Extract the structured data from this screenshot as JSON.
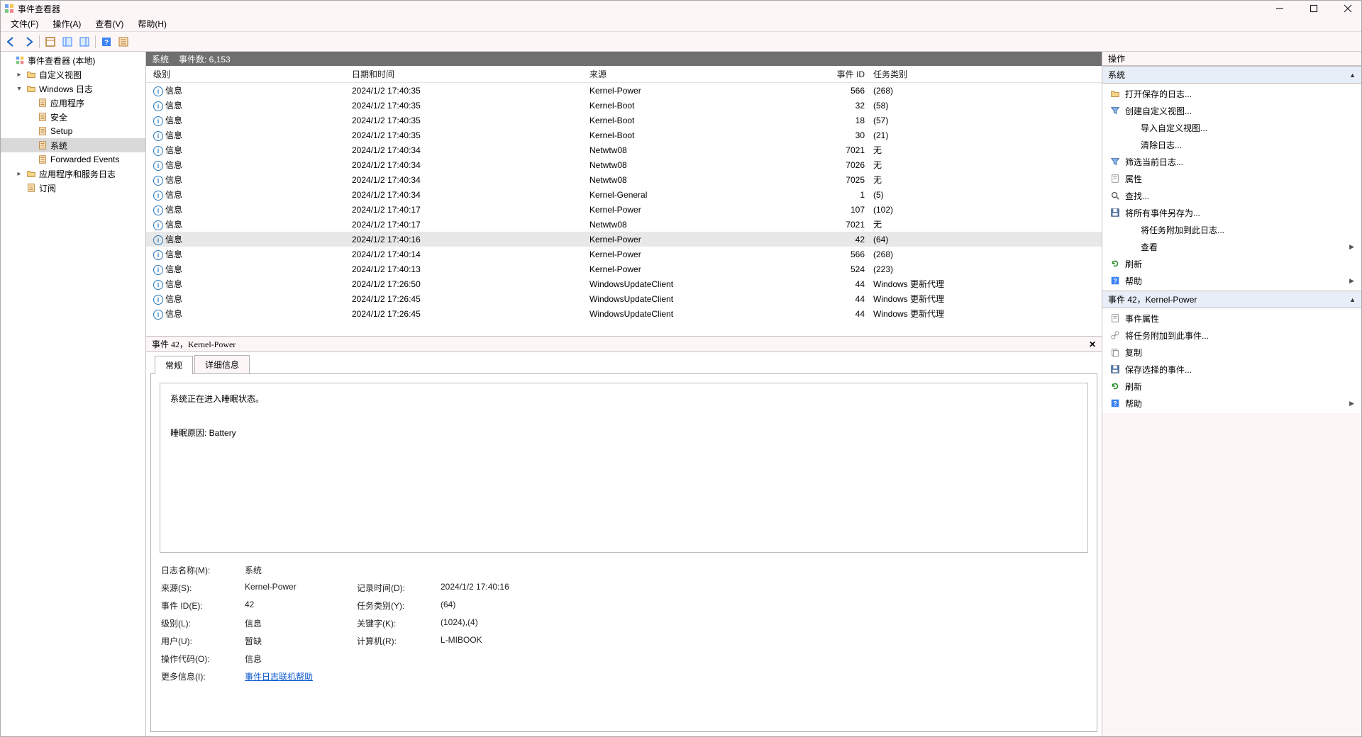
{
  "window": {
    "title": "事件查看器"
  },
  "menubar": [
    "文件(F)",
    "操作(A)",
    "查看(V)",
    "帮助(H)"
  ],
  "tree": {
    "root": "事件查看器 (本地)",
    "items": [
      {
        "label": "自定义视图",
        "indent": 1,
        "exp": "▶"
      },
      {
        "label": "Windows 日志",
        "indent": 1,
        "exp": "▼"
      },
      {
        "label": "应用程序",
        "indent": 2
      },
      {
        "label": "安全",
        "indent": 2
      },
      {
        "label": "Setup",
        "indent": 2
      },
      {
        "label": "系统",
        "indent": 2,
        "selected": true
      },
      {
        "label": "Forwarded Events",
        "indent": 2
      },
      {
        "label": "应用程序和服务日志",
        "indent": 1,
        "exp": "▶"
      },
      {
        "label": "订阅",
        "indent": 1
      }
    ]
  },
  "center_header": {
    "log_name": "系统",
    "count_label": "事件数: 6,153"
  },
  "columns": {
    "level": "级别",
    "datetime": "日期和时间",
    "source": "来源",
    "eventid": "事件 ID",
    "category": "任务类别"
  },
  "events": [
    {
      "level": "信息",
      "dt": "2024/1/2 17:40:35",
      "src": "Kernel-Power",
      "id": "566",
      "cat": "(268)"
    },
    {
      "level": "信息",
      "dt": "2024/1/2 17:40:35",
      "src": "Kernel-Boot",
      "id": "32",
      "cat": "(58)"
    },
    {
      "level": "信息",
      "dt": "2024/1/2 17:40:35",
      "src": "Kernel-Boot",
      "id": "18",
      "cat": "(57)"
    },
    {
      "level": "信息",
      "dt": "2024/1/2 17:40:35",
      "src": "Kernel-Boot",
      "id": "30",
      "cat": "(21)"
    },
    {
      "level": "信息",
      "dt": "2024/1/2 17:40:34",
      "src": "Netwtw08",
      "id": "7021",
      "cat": "无"
    },
    {
      "level": "信息",
      "dt": "2024/1/2 17:40:34",
      "src": "Netwtw08",
      "id": "7026",
      "cat": "无"
    },
    {
      "level": "信息",
      "dt": "2024/1/2 17:40:34",
      "src": "Netwtw08",
      "id": "7025",
      "cat": "无"
    },
    {
      "level": "信息",
      "dt": "2024/1/2 17:40:34",
      "src": "Kernel-General",
      "id": "1",
      "cat": "(5)"
    },
    {
      "level": "信息",
      "dt": "2024/1/2 17:40:17",
      "src": "Kernel-Power",
      "id": "107",
      "cat": "(102)"
    },
    {
      "level": "信息",
      "dt": "2024/1/2 17:40:17",
      "src": "Netwtw08",
      "id": "7021",
      "cat": "无"
    },
    {
      "level": "信息",
      "dt": "2024/1/2 17:40:16",
      "src": "Kernel-Power",
      "id": "42",
      "cat": "(64)",
      "selected": true
    },
    {
      "level": "信息",
      "dt": "2024/1/2 17:40:14",
      "src": "Kernel-Power",
      "id": "566",
      "cat": "(268)"
    },
    {
      "level": "信息",
      "dt": "2024/1/2 17:40:13",
      "src": "Kernel-Power",
      "id": "524",
      "cat": "(223)"
    },
    {
      "level": "信息",
      "dt": "2024/1/2 17:26:50",
      "src": "WindowsUpdateClient",
      "id": "44",
      "cat": "Windows 更新代理"
    },
    {
      "level": "信息",
      "dt": "2024/1/2 17:26:45",
      "src": "WindowsUpdateClient",
      "id": "44",
      "cat": "Windows 更新代理"
    },
    {
      "level": "信息",
      "dt": "2024/1/2 17:26:45",
      "src": "WindowsUpdateClient",
      "id": "44",
      "cat": "Windows 更新代理"
    }
  ],
  "detail": {
    "header": "事件 42，Kernel-Power",
    "tabs": {
      "general": "常规",
      "details": "详细信息"
    },
    "message": "系统正在进入睡眠状态。\n\n睡眠原因: Battery",
    "props": {
      "log_name_lbl": "日志名称(M):",
      "log_name": "系统",
      "source_lbl": "来源(S):",
      "source": "Kernel-Power",
      "logged_lbl": "记录时间(D):",
      "logged": "2024/1/2 17:40:16",
      "eventid_lbl": "事件 ID(E):",
      "eventid": "42",
      "taskcat_lbl": "任务类别(Y):",
      "taskcat": "(64)",
      "level_lbl": "级别(L):",
      "level": "信息",
      "keywords_lbl": "关键字(K):",
      "keywords": "(1024),(4)",
      "user_lbl": "用户(U):",
      "user": "暂缺",
      "computer_lbl": "计算机(R):",
      "computer": "L-MIBOOK",
      "opcode_lbl": "操作代码(O):",
      "opcode": "信息",
      "more_lbl": "更多信息(I):",
      "more_link": "事件日志联机帮助"
    }
  },
  "actions": {
    "title": "操作",
    "section1": "系统",
    "section2": "事件 42，Kernel-Power",
    "items1": [
      {
        "icon": "open",
        "label": "打开保存的日志..."
      },
      {
        "icon": "filter",
        "label": "创建自定义视图..."
      },
      {
        "icon": "none",
        "label": "导入自定义视图...",
        "indent": true
      },
      {
        "icon": "none",
        "label": "清除日志...",
        "indent": true
      },
      {
        "icon": "filter",
        "label": "筛选当前日志..."
      },
      {
        "icon": "props",
        "label": "属性"
      },
      {
        "icon": "find",
        "label": "查找..."
      },
      {
        "icon": "save",
        "label": "将所有事件另存为..."
      },
      {
        "icon": "none",
        "label": "将任务附加到此日志...",
        "indent": true
      },
      {
        "icon": "none",
        "label": "查看",
        "indent": true,
        "sub": true
      },
      {
        "icon": "refresh",
        "label": "刷新"
      },
      {
        "icon": "help",
        "label": "帮助",
        "sub": true
      }
    ],
    "items2": [
      {
        "icon": "props",
        "label": "事件属性"
      },
      {
        "icon": "attach",
        "label": "将任务附加到此事件..."
      },
      {
        "icon": "copy",
        "label": "复制"
      },
      {
        "icon": "save",
        "label": "保存选择的事件..."
      },
      {
        "icon": "refresh",
        "label": "刷新"
      },
      {
        "icon": "help",
        "label": "帮助",
        "sub": true
      }
    ]
  }
}
